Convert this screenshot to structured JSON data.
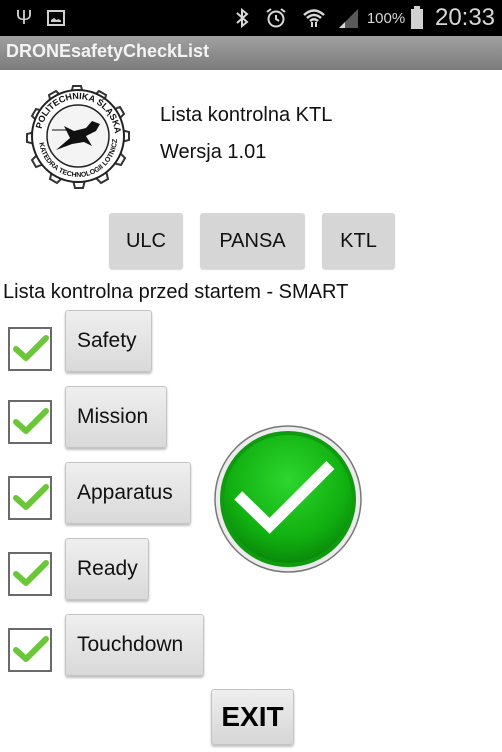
{
  "status_bar": {
    "icons_left": [
      "usb-icon",
      "gallery-icon"
    ],
    "icons_right": [
      "bluetooth-icon",
      "alarm-icon",
      "wifi-icon",
      "signal-icon"
    ],
    "battery_percent": "100%",
    "time": "20:33"
  },
  "app": {
    "title": "DRONEsafetyCheckList"
  },
  "header": {
    "logo": "politechnika-slaska-ktl-logo",
    "heading": "Lista kontrolna KTL",
    "version": "Wersja 1.01"
  },
  "nav_buttons": [
    {
      "label": "ULC"
    },
    {
      "label": "PANSA"
    },
    {
      "label": "KTL"
    }
  ],
  "checklist": {
    "title": "Lista kontrolna przed startem - SMART",
    "items": [
      {
        "label": "Safety",
        "checked": true
      },
      {
        "label": "Mission",
        "checked": true
      },
      {
        "label": "Apparatus",
        "checked": true
      },
      {
        "label": "Ready",
        "checked": true
      },
      {
        "label": "Touchdown",
        "checked": true
      }
    ],
    "status_icon": "all-complete-check-icon"
  },
  "footer": {
    "exit_label": "EXIT"
  },
  "colors": {
    "check_green": "#6cc63a",
    "status_green": "#12b012",
    "titlebar": "#8e8e8e"
  }
}
